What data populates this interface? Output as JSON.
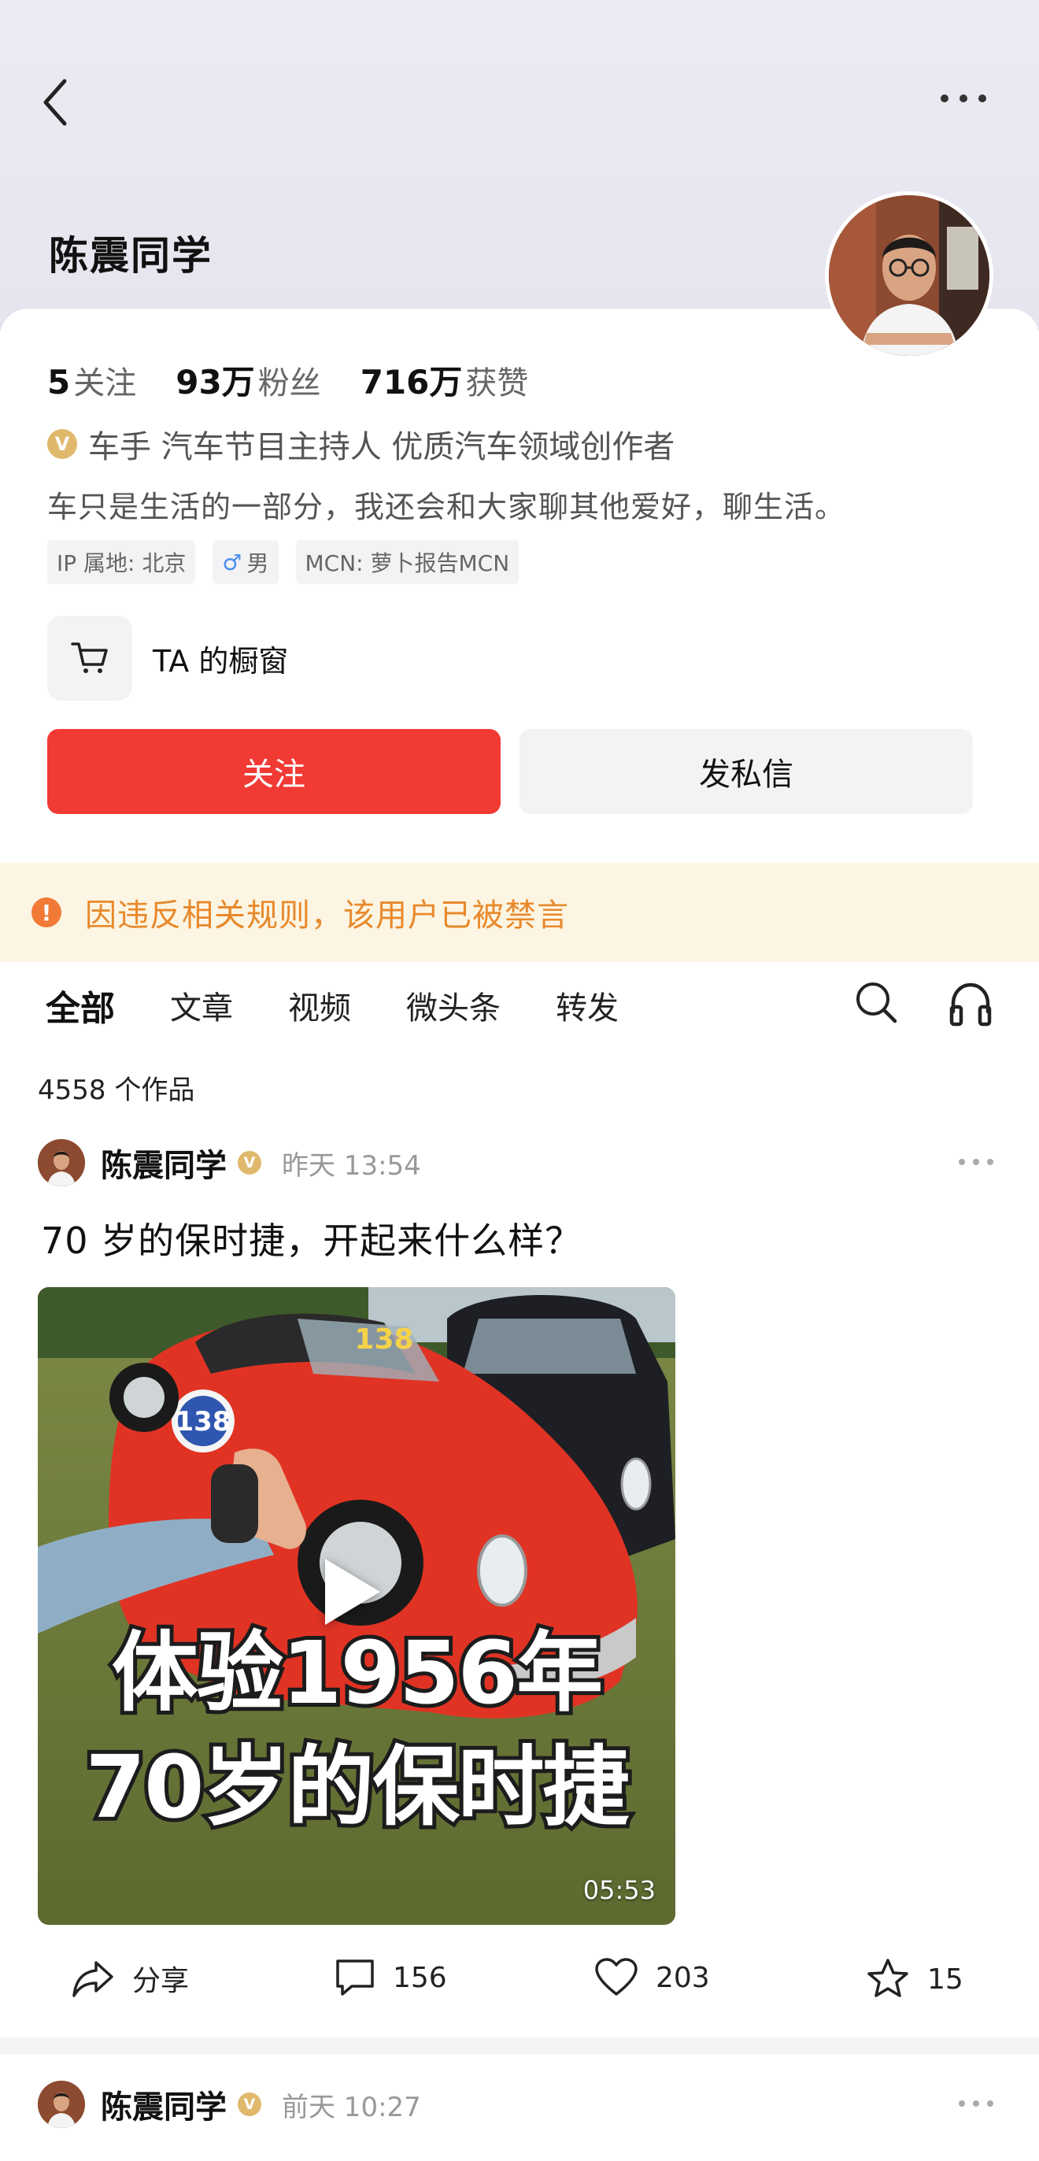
{
  "header": {
    "user_name": "陈震同学"
  },
  "stats": [
    {
      "num": "5",
      "label": "关注"
    },
    {
      "num": "93万",
      "label": "粉丝"
    },
    {
      "num": "716万",
      "label": "获赞"
    }
  ],
  "verification": {
    "badge": "V",
    "text": "车手 汽车节目主持人 优质汽车领域创作者"
  },
  "bio": "车只是生活的一部分，我还会和大家聊其他爱好，聊生活。",
  "tags": {
    "ip": "IP 属地: 北京",
    "gender": "男",
    "mcn": "MCN: 萝卜报告MCN"
  },
  "shop": {
    "label": "TA 的橱窗"
  },
  "buttons": {
    "follow": "关注",
    "message": "发私信"
  },
  "ban_notice": {
    "icon": "!",
    "text": "因违反相关规则，该用户已被禁言"
  },
  "tabs": [
    "全部",
    "文章",
    "视频",
    "微头条",
    "转发"
  ],
  "works_count": "4558 个作品",
  "posts": [
    {
      "author": "陈震同学",
      "time": "昨天 13:54",
      "title": "70 岁的保时捷，开起来什么样？",
      "video": {
        "caption_line1": "体验1956年",
        "caption_line2": "70岁的保时捷",
        "duration": "05:53",
        "plate": "138"
      },
      "actions": {
        "share": "分享",
        "comments": "156",
        "likes": "203",
        "stars": "15"
      }
    },
    {
      "author": "陈震同学",
      "time": "前天 10:27"
    }
  ],
  "colors": {
    "accent": "#f23a35",
    "ban_bg": "#fdf5e3",
    "ban_text": "#e8892b",
    "verify": "#e0b86c"
  }
}
